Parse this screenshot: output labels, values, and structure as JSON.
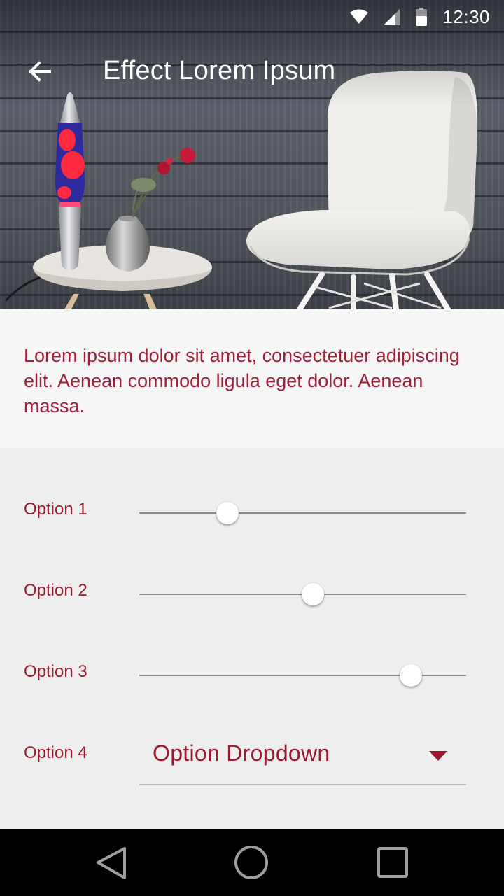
{
  "status_bar": {
    "time": "12:30",
    "icons": [
      "wifi-icon",
      "signal-icon",
      "battery-icon"
    ]
  },
  "app_bar": {
    "title": "Effect Lorem Ipsum",
    "back_icon": "arrow-back-icon"
  },
  "hero_image": {
    "subject": "lava-lamp-vase-and-white-chair"
  },
  "description": {
    "text": "Lorem ipsum dolor sit amet, consectetuer adipiscing elit. Aenean commodo ligula eget dolor. Aenean massa."
  },
  "options": [
    {
      "label": "Option 1",
      "type": "slider",
      "value": 0.27
    },
    {
      "label": "Option 2",
      "type": "slider",
      "value": 0.53
    },
    {
      "label": "Option 3",
      "type": "slider",
      "value": 0.83
    },
    {
      "label": "Option 4",
      "type": "dropdown",
      "value": "Option Dropdown"
    }
  ],
  "nav_bar": {
    "icons": [
      "back-triangle-icon",
      "home-circle-icon",
      "recents-square-icon"
    ]
  },
  "colors": {
    "accent": "#9b1a30",
    "description_text": "#a31e3a",
    "panel_background": "#eeeeee",
    "description_background": "#f6f6f6",
    "nav_background": "#000000"
  }
}
